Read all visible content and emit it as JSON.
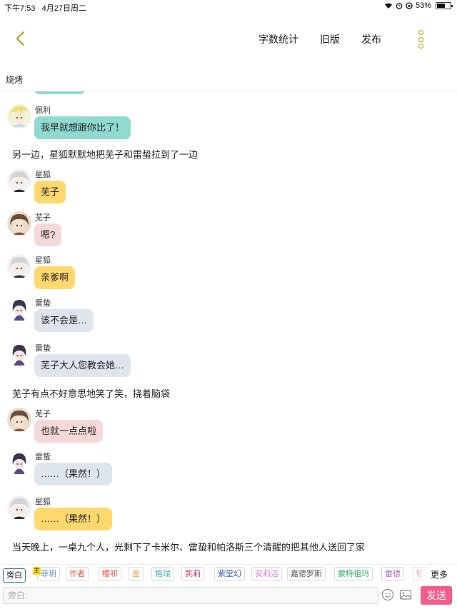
{
  "status_bar": {
    "time": "下午7:53",
    "date": "4月27日周二",
    "battery": "53%"
  },
  "nav": {
    "word_count": "字数统计",
    "old_version": "旧版",
    "publish": "发布"
  },
  "scene_title": "烧烤",
  "messages": [
    {
      "type": "chat",
      "speaker": "佩利",
      "text": "我早就想跟你比了！",
      "color": "#8fd9cf"
    },
    {
      "type": "narration",
      "text": "另一边，星狐默默地把芜子和雷蛰拉到了一边"
    },
    {
      "type": "chat",
      "speaker": "星狐",
      "text": "芜子",
      "color": "#ffd86e"
    },
    {
      "type": "chat",
      "speaker": "芜子",
      "text": "嗯?",
      "color": "#f5d9d9"
    },
    {
      "type": "chat",
      "speaker": "星狐",
      "text": "亲爹啊",
      "color": "#ffd86e"
    },
    {
      "type": "chat",
      "speaker": "雷蛰",
      "text": "该不会是…",
      "color": "#dfe5ec"
    },
    {
      "type": "chat",
      "speaker": "雷蛰",
      "text": "芜子大人您教会她…",
      "color": "#dfe5ec"
    },
    {
      "type": "narration",
      "text": "芜子有点不好意思地笑了笑，挠着脑袋"
    },
    {
      "type": "chat",
      "speaker": "芜子",
      "text": "也就一点点啦",
      "color": "#f5d9d9"
    },
    {
      "type": "chat",
      "speaker": "雷蛰",
      "text": "……（果然！）",
      "color": "#dfe5ec"
    },
    {
      "type": "chat",
      "speaker": "星狐",
      "text": "……（果然！）",
      "color": "#ffd86e"
    },
    {
      "type": "narration",
      "text": "当天晚上，一桌九个人，光剩下了卡米尔、雷蛰和帕洛斯三个清醒的把其他人送回了家"
    }
  ],
  "roles": [
    {
      "label": "旁白",
      "color": "#222222",
      "selected": true
    },
    {
      "label": "菲玥",
      "color": "#5b8fd6",
      "main": true
    },
    {
      "label": "作者",
      "color": "#e0533c"
    },
    {
      "label": "樱祁",
      "color": "#e0533c"
    },
    {
      "label": "金",
      "color": "#e6a23c"
    },
    {
      "label": "格瑞",
      "color": "#4ab0b0"
    },
    {
      "label": "凯莉",
      "color": "#c0306a"
    },
    {
      "label": "紫堂幻",
      "color": "#3a5fbf"
    },
    {
      "label": "安莉洁",
      "color": "#e07ad9"
    },
    {
      "label": "嘉德罗斯",
      "color": "#555555"
    },
    {
      "label": "蒙特祖玛",
      "color": "#2fae6b"
    },
    {
      "label": "雷德",
      "color": "#a060c0"
    },
    {
      "label": "银",
      "color": "#d04040"
    }
  ],
  "main_tag": "主",
  "more_label": "更多",
  "input": {
    "placeholder": "旁白:",
    "send_label": "发送"
  }
}
